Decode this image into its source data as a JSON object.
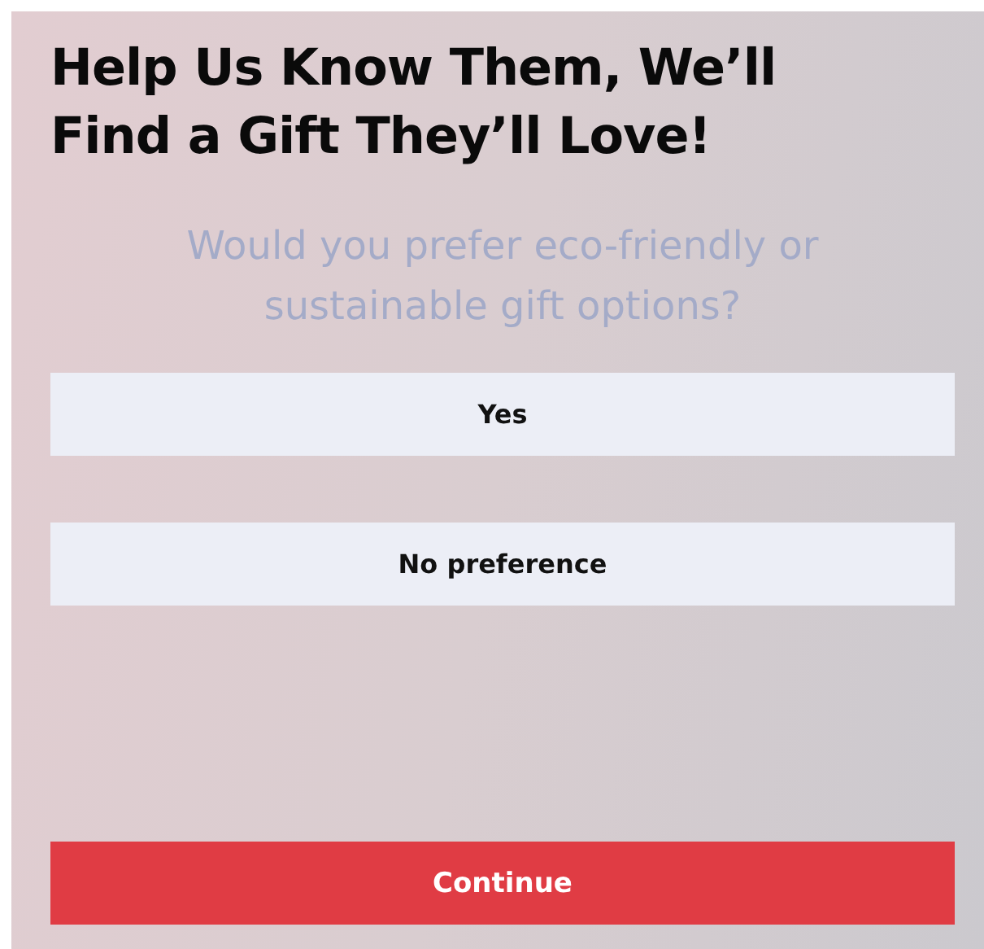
{
  "title": "Help Us Know Them, We’ll Find a Gift They’ll Love!",
  "question": "Would you prefer eco-friendly or sustainable gift options?",
  "options": [
    {
      "label": "Yes"
    },
    {
      "label": "No preference"
    }
  ],
  "continue_button": "Continue"
}
